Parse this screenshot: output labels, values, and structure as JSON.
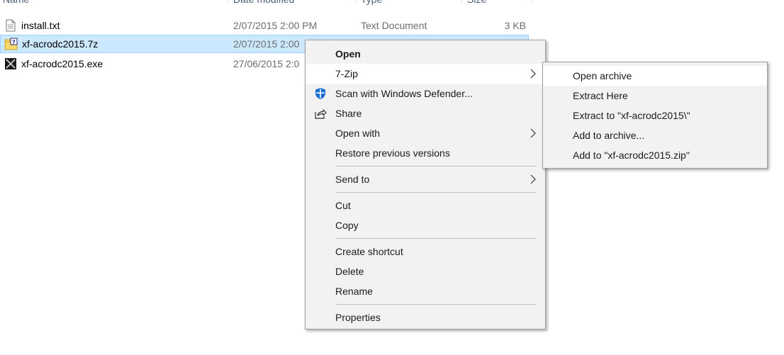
{
  "columns": {
    "name": "Name",
    "date": "Date modified",
    "type": "Type",
    "size": "Size"
  },
  "files": [
    {
      "name": "install.txt",
      "date": "2/07/2015 2:00 PM",
      "type": "Text Document",
      "size": "3 KB",
      "icon": "text-file-icon"
    },
    {
      "name": "xf-acrodc2015.7z",
      "date": "2/07/2015 2:00",
      "icon": "7z-archive-icon",
      "selected": true
    },
    {
      "name": "xf-acrodc2015.exe",
      "date": "27/06/2015 2:0",
      "icon": "exe-app-icon"
    }
  ],
  "context_menu": {
    "open": "Open",
    "seven_zip": "7-Zip",
    "scan": "Scan with Windows Defender...",
    "share": "Share",
    "open_with": "Open with",
    "restore": "Restore previous versions",
    "send_to": "Send to",
    "cut": "Cut",
    "copy": "Copy",
    "create_shortcut": "Create shortcut",
    "delete": "Delete",
    "rename": "Rename",
    "properties": "Properties"
  },
  "submenu_7zip": {
    "open_archive": "Open archive",
    "extract_here": "Extract Here",
    "extract_to": "Extract to \"xf-acrodc2015\\\"",
    "add_archive": "Add to archive...",
    "add_zip": "Add to \"xf-acrodc2015.zip\""
  },
  "colors": {
    "selection_bg": "#cce8ff",
    "selection_border": "#99d1ff",
    "menu_bg": "#f2f2f2",
    "defender_blue": "#1c6fd1"
  }
}
